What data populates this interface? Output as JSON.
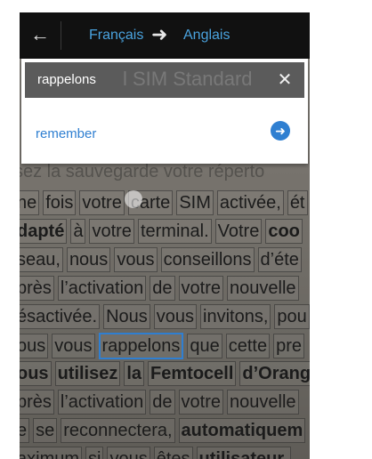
{
  "header": {
    "source_lang": "Français",
    "target_lang": "Anglais"
  },
  "search": {
    "query": "rappelons",
    "ghost_text": "l SIM Standard"
  },
  "result": {
    "translation": "remember"
  },
  "document": {
    "faint_line": "sez la sauvegarde votre réperto",
    "lines": [
      [
        {
          "t": "ne"
        },
        {
          "t": "fois"
        },
        {
          "t": "votre"
        },
        {
          "t": "carte"
        },
        {
          "t": "SIM"
        },
        {
          "t": "activée,"
        },
        {
          "t": "ét"
        }
      ],
      [
        {
          "t": "dapté",
          "b": true
        },
        {
          "t": "à"
        },
        {
          "t": "votre"
        },
        {
          "t": "terminal."
        },
        {
          "t": "Votre"
        },
        {
          "t": "coo",
          "b": true
        }
      ],
      [
        {
          "t": "seau,"
        },
        {
          "t": "nous"
        },
        {
          "t": "vous"
        },
        {
          "t": "conseillons"
        },
        {
          "t": "d’éte"
        }
      ],
      [
        {
          "t": "près"
        },
        {
          "t": "l’activation"
        },
        {
          "t": "de"
        },
        {
          "t": "votre"
        },
        {
          "t": "nouvelle"
        }
      ],
      [
        {
          "t": "ésactivée."
        },
        {
          "t": "Nous"
        },
        {
          "t": "vous"
        },
        {
          "t": "invitons,"
        },
        {
          "t": "pou"
        }
      ],
      [
        {
          "t": "ous"
        },
        {
          "t": "vous"
        },
        {
          "t": "rappelons",
          "sel": true
        },
        {
          "t": "que"
        },
        {
          "t": "cette"
        },
        {
          "t": "pre"
        }
      ],
      [
        {
          "t": "ous",
          "b": true
        },
        {
          "t": "utilisez",
          "b": true
        },
        {
          "t": "la",
          "b": true
        },
        {
          "t": "Femtocell",
          "b": true
        },
        {
          "t": "d’Orange",
          "b": true
        }
      ],
      [
        {
          "t": "près"
        },
        {
          "t": "l’activation"
        },
        {
          "t": "de"
        },
        {
          "t": "votre"
        },
        {
          "t": "nouvelle"
        }
      ],
      [
        {
          "t": "e"
        },
        {
          "t": "se"
        },
        {
          "t": "reconnectera,"
        },
        {
          "t": "automatiquem",
          "b": true
        }
      ],
      [
        {
          "t": "aximum"
        },
        {
          "t": "si"
        },
        {
          "t": "vous"
        },
        {
          "t": "êtes"
        },
        {
          "t": "utilisateur.",
          "b": true
        }
      ]
    ]
  }
}
